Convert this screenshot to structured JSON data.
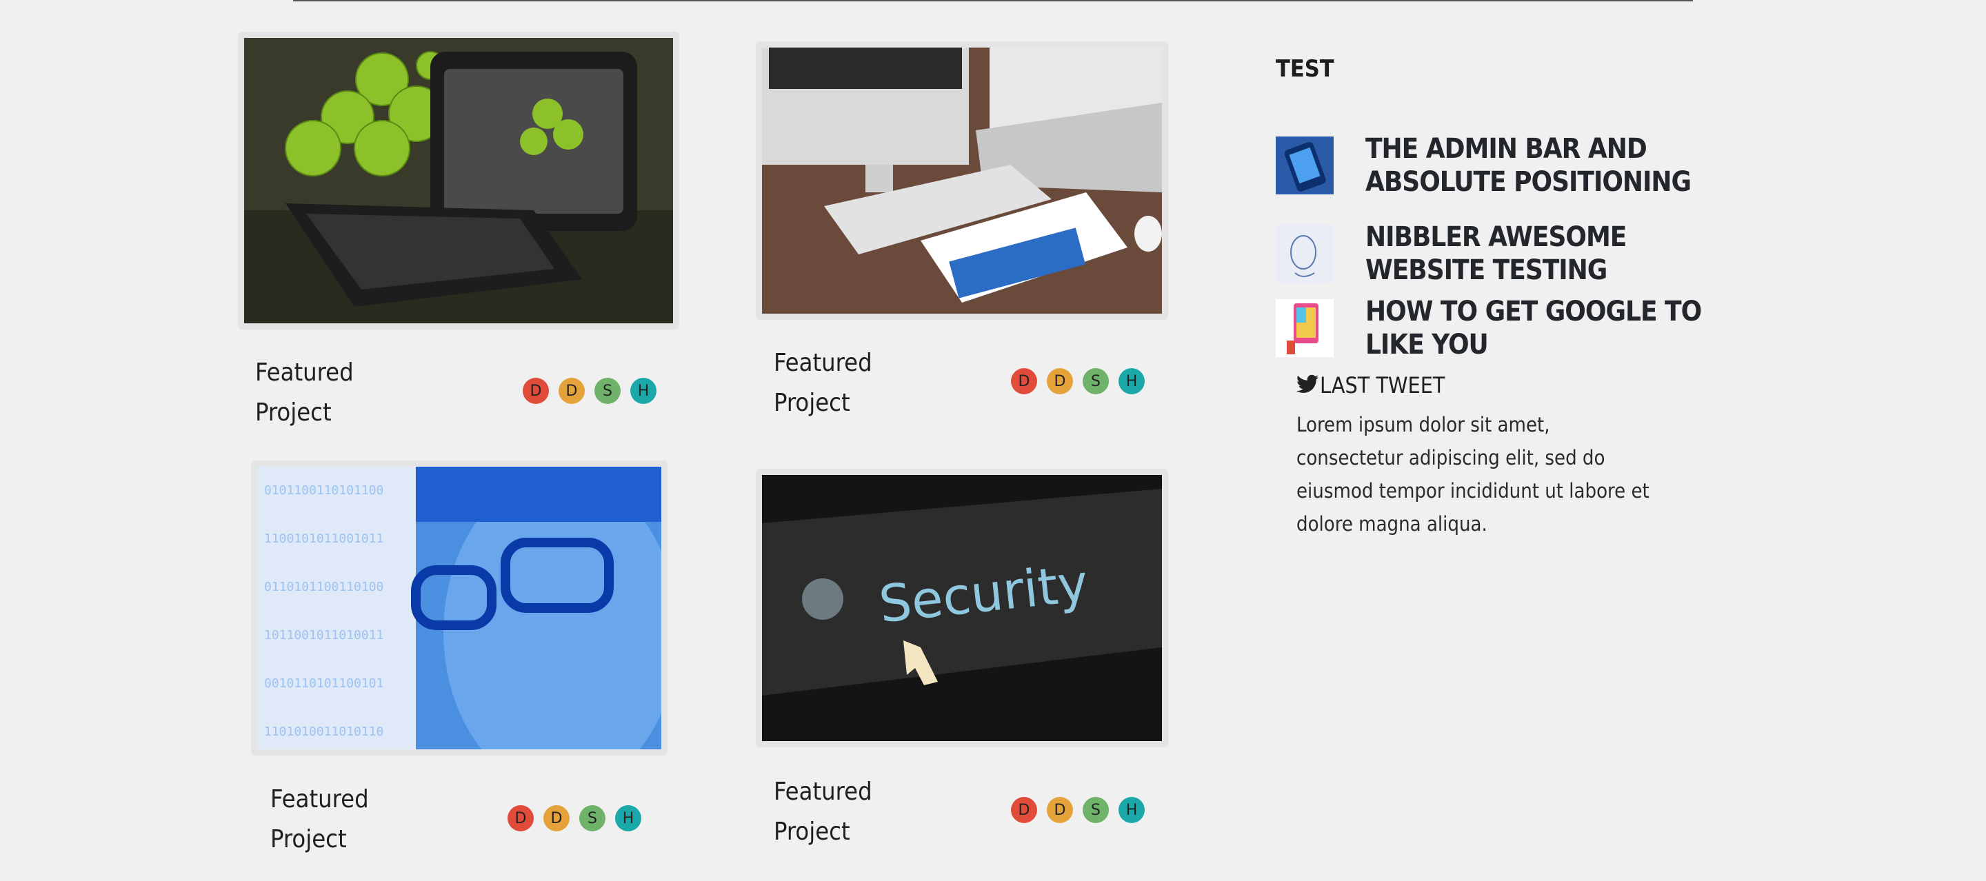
{
  "projects": [
    {
      "title": "Featured Project",
      "image_subject": "apples-and-tablet-keyboard",
      "badges": [
        {
          "letter": "D",
          "color": "#e04b3a"
        },
        {
          "letter": "D",
          "color": "#e6a23a"
        },
        {
          "letter": "S",
          "color": "#6fb26a"
        },
        {
          "letter": "H",
          "color": "#1aa8a8"
        }
      ]
    },
    {
      "title": "Featured Project",
      "image_subject": "desk-with-computer-laptop-tablet",
      "badges": [
        {
          "letter": "D",
          "color": "#e04b3a"
        },
        {
          "letter": "D",
          "color": "#e6a23a"
        },
        {
          "letter": "S",
          "color": "#6fb26a"
        },
        {
          "letter": "H",
          "color": "#1aa8a8"
        }
      ]
    },
    {
      "title": "Featured Project",
      "image_subject": "binary-face-with-glasses",
      "badges": [
        {
          "letter": "D",
          "color": "#e04b3a"
        },
        {
          "letter": "D",
          "color": "#e6a23a"
        },
        {
          "letter": "S",
          "color": "#6fb26a"
        },
        {
          "letter": "H",
          "color": "#1aa8a8"
        }
      ]
    },
    {
      "title": "Featured Project",
      "image_subject": "security-screen-cursor",
      "image_text": "Security",
      "badges": [
        {
          "letter": "D",
          "color": "#e04b3a"
        },
        {
          "letter": "D",
          "color": "#e6a23a"
        },
        {
          "letter": "S",
          "color": "#6fb26a"
        },
        {
          "letter": "H",
          "color": "#1aa8a8"
        }
      ]
    }
  ],
  "sidebar": {
    "title": "TEST",
    "posts": [
      {
        "title": "THE ADMIN BAR AND ABSOLUTE POSITIONING",
        "icon": "phone-thumbnail"
      },
      {
        "title": "NIBBLER AWESOME WEBSITE TESTING",
        "icon": "sketch-face-thumbnail"
      },
      {
        "title": "HOW TO GET GOOGLE TO LIKE YOU",
        "icon": "colorful-phone-thumbnail"
      }
    ],
    "tweet": {
      "icon": "twitter-bird-icon",
      "heading": "LAST TWEET",
      "text": "Lorem ipsum dolor sit amet, consectetur adipiscing elit, sed do eiusmod tempor incididunt ut labore et dolore magna aliqua."
    }
  },
  "colors": {
    "background": "#f0f0f0",
    "text": "#23262b"
  }
}
